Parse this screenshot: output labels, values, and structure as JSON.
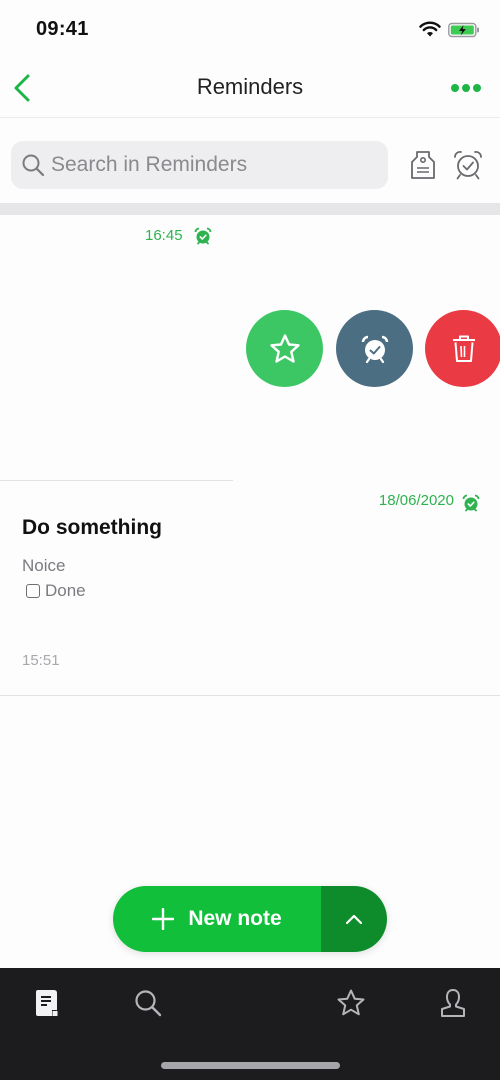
{
  "status_bar": {
    "time": "09:41",
    "icons": [
      "wifi-icon",
      "battery-charging-icon"
    ]
  },
  "nav": {
    "title": "Reminders",
    "back_icon": "chevron-left-icon",
    "more_icon": "more-horizontal-icon"
  },
  "search": {
    "placeholder": "Search in Reminders",
    "value": "",
    "icon": "search-icon",
    "tag_icon": "tag-icon",
    "alarm_icon": "alarm-check-icon"
  },
  "notes": [
    {
      "reminder_time": "16:45",
      "reminder_icon": "alarm-check-icon",
      "swipe_actions": [
        {
          "name": "star",
          "icon": "star-icon",
          "color": "#3dc764"
        },
        {
          "name": "reminder",
          "icon": "alarm-check-icon",
          "color": "#4b6e82"
        },
        {
          "name": "delete",
          "icon": "trash-icon",
          "color": "#ea3b44"
        }
      ]
    },
    {
      "reminder_date": "18/06/2020",
      "reminder_icon": "alarm-check-icon",
      "title": "Do something",
      "body": "Noice",
      "checklist": [
        {
          "label": "Done",
          "checked": false
        }
      ],
      "updated": "15:51"
    }
  ],
  "new_note": {
    "label": "New note",
    "icon": "plus-icon",
    "expand_icon": "chevron-up-icon"
  },
  "tab_bar": {
    "tabs": [
      {
        "name": "notes",
        "icon": "note-icon",
        "active": true
      },
      {
        "name": "search",
        "icon": "search-icon",
        "active": false
      },
      {
        "name": "shortcuts",
        "icon": "star-icon",
        "active": false
      },
      {
        "name": "account",
        "icon": "person-icon",
        "active": false
      }
    ]
  },
  "colors": {
    "accent": "#11bf3b",
    "accent_dark": "#0e8c2b",
    "reminder_green": "#2eb34f",
    "tab_bar_bg": "#1c1b1e"
  }
}
